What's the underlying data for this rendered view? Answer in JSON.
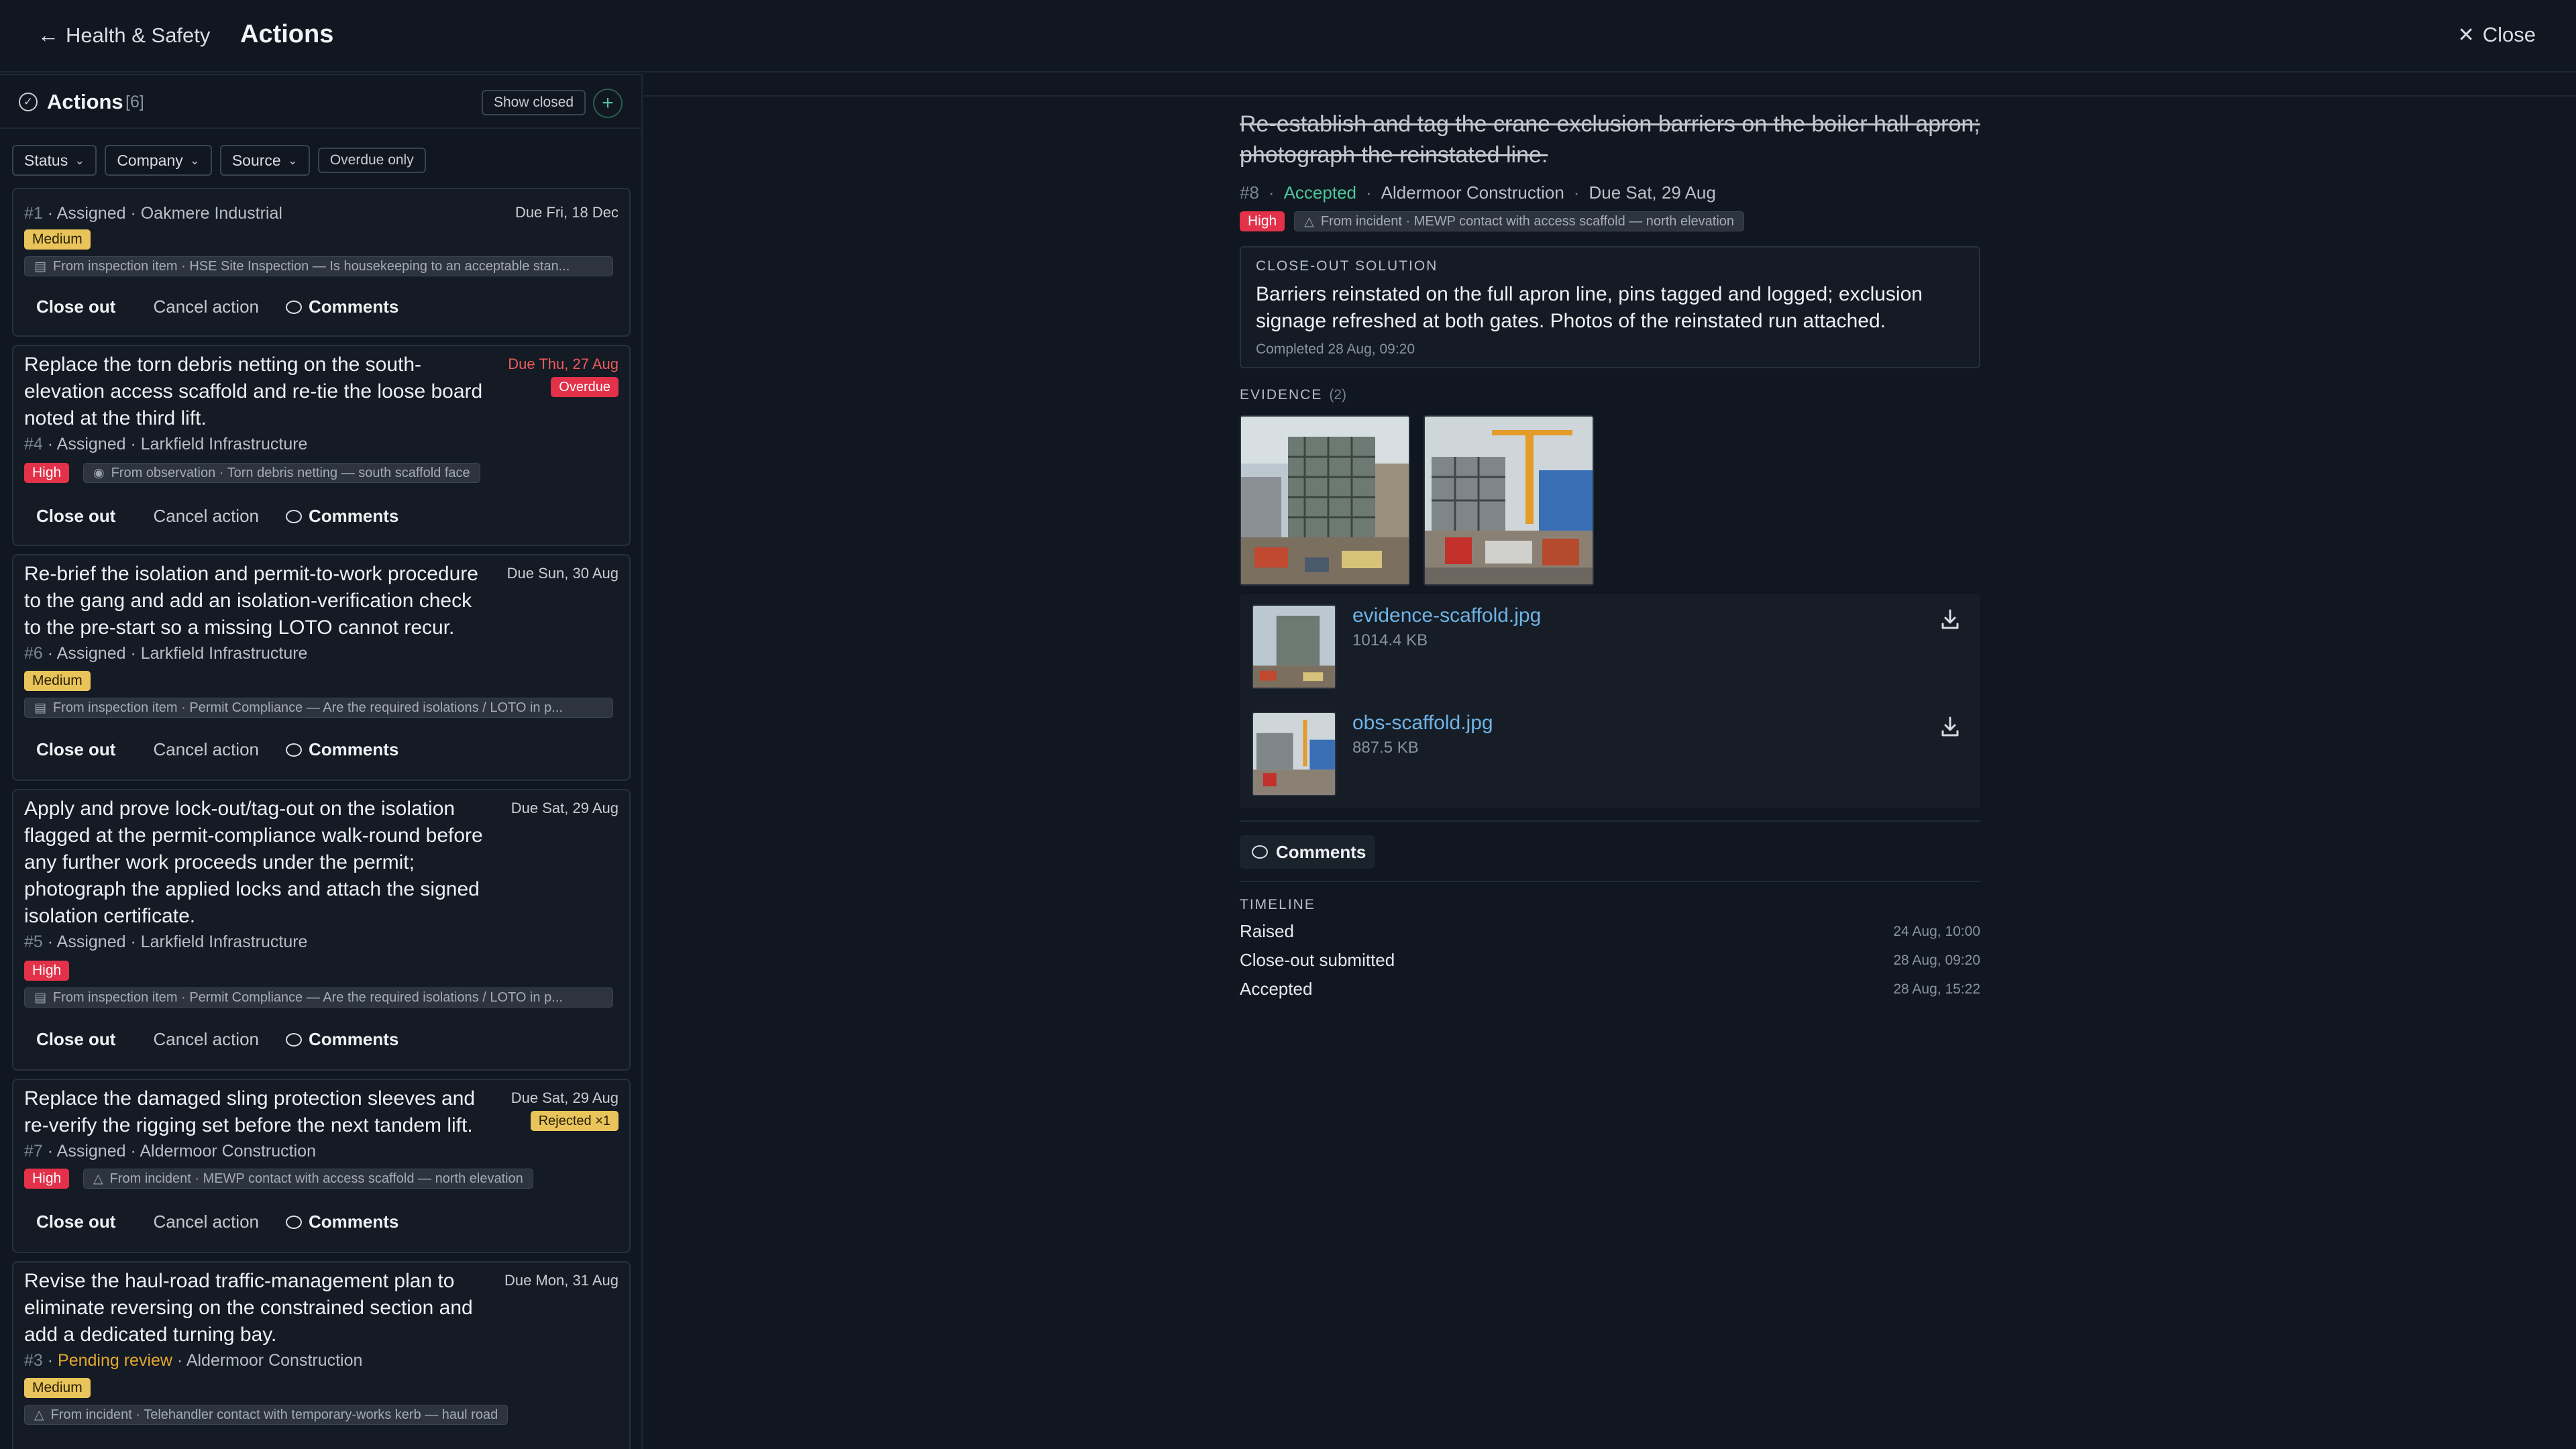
{
  "topbar": {
    "back_label": "Health & Safety",
    "title": "Actions",
    "close_label": "Close"
  },
  "list": {
    "title": "Actions",
    "count": "[6]",
    "show_closed": "Show closed",
    "filters": {
      "status": "Status",
      "company": "Company",
      "source": "Source",
      "overdue": "Overdue only"
    },
    "actions": {
      "close_out": "Close out",
      "cancel": "Cancel action",
      "comments": "Comments"
    },
    "cards": [
      {
        "num": "#1",
        "status": "Assigned",
        "company": "Oakmere Industrial",
        "due": "Due Fri, 18 Dec",
        "title": "",
        "priority": "Medium",
        "source": "From inspection item · HSE Site Inspection — Is housekeeping to an acceptable stan..."
      },
      {
        "num": "#4",
        "status": "Assigned",
        "company": "Larkfield Infrastructure",
        "due": "Due Thu, 27 Aug",
        "badge": "Overdue",
        "title": "Replace the torn debris netting on the south-elevation access scaffold and re-tie the loose board noted at the third lift.",
        "priority": "High",
        "source": "From observation · Torn debris netting — south scaffold face"
      },
      {
        "num": "#6",
        "status": "Assigned",
        "company": "Larkfield Infrastructure",
        "due": "Due Sun, 30 Aug",
        "title": "Re-brief the isolation and permit-to-work procedure to the gang and add an isolation-verification check to the pre-start so a missing LOTO cannot recur.",
        "priority": "Medium",
        "source": "From inspection item · Permit Compliance — Are the required isolations / LOTO in p..."
      },
      {
        "num": "#5",
        "status": "Assigned",
        "company": "Larkfield Infrastructure",
        "due": "Due Sat, 29 Aug",
        "title": "Apply and prove lock-out/tag-out on the isolation flagged at the permit-compliance walk-round before any further work proceeds under the permit; photograph the applied locks and attach the signed isolation certificate.",
        "priority": "High",
        "source": "From inspection item · Permit Compliance — Are the required isolations / LOTO in p..."
      },
      {
        "num": "#7",
        "status": "Assigned",
        "company": "Aldermoor Construction",
        "due": "Due Sat, 29 Aug",
        "badge": "Rejected ×1",
        "title": "Replace the damaged sling protection sleeves and re-verify the rigging set before the next tandem lift.",
        "priority": "High",
        "source": "From incident · MEWP contact with access scaffold — north elevation"
      },
      {
        "num": "#3",
        "status": "Pending review",
        "company": "Aldermoor Construction",
        "due": "Due Mon, 31 Aug",
        "title": "Revise the haul-road traffic-management plan to eliminate reversing on the constrained section and add a dedicated turning bay.",
        "priority": "Medium",
        "source": "From incident · Telehandler contact with temporary-works kerb — haul road"
      }
    ]
  },
  "detail": {
    "title": "Re-establish and tag the crane exclusion barriers on the boiler hall apron; photograph the reinstated line.",
    "num": "#8",
    "status": "Accepted",
    "company": "Aldermoor Construction",
    "due": "Due Sat, 29 Aug",
    "priority": "High",
    "source": "From incident · MEWP contact with access scaffold — north elevation",
    "solution_label": "CLOSE-OUT SOLUTION",
    "solution_text": "Barriers reinstated on the full apron line, pins tagged and logged; exclusion signage refreshed at both gates. Photos of the reinstated run attached.",
    "completed": "Completed 28 Aug, 09:20",
    "evidence_label": "EVIDENCE",
    "evidence_count": "(2)",
    "files": [
      {
        "name": "evidence-scaffold.jpg",
        "size": "1014.4 KB"
      },
      {
        "name": "obs-scaffold.jpg",
        "size": "887.5 KB"
      }
    ],
    "comments_label": "Comments",
    "timeline_label": "TIMELINE",
    "timeline": [
      {
        "event": "Raised",
        "time": "24 Aug, 10:00"
      },
      {
        "event": "Close-out submitted",
        "time": "28 Aug, 09:20"
      },
      {
        "event": "Accepted",
        "time": "28 Aug, 15:22"
      }
    ]
  },
  "colors": {
    "accent_green": "#4fc79a",
    "high": "#e23149",
    "medium": "#e8c45a",
    "link": "#6fb3e6",
    "pending": "#e3a72f"
  }
}
